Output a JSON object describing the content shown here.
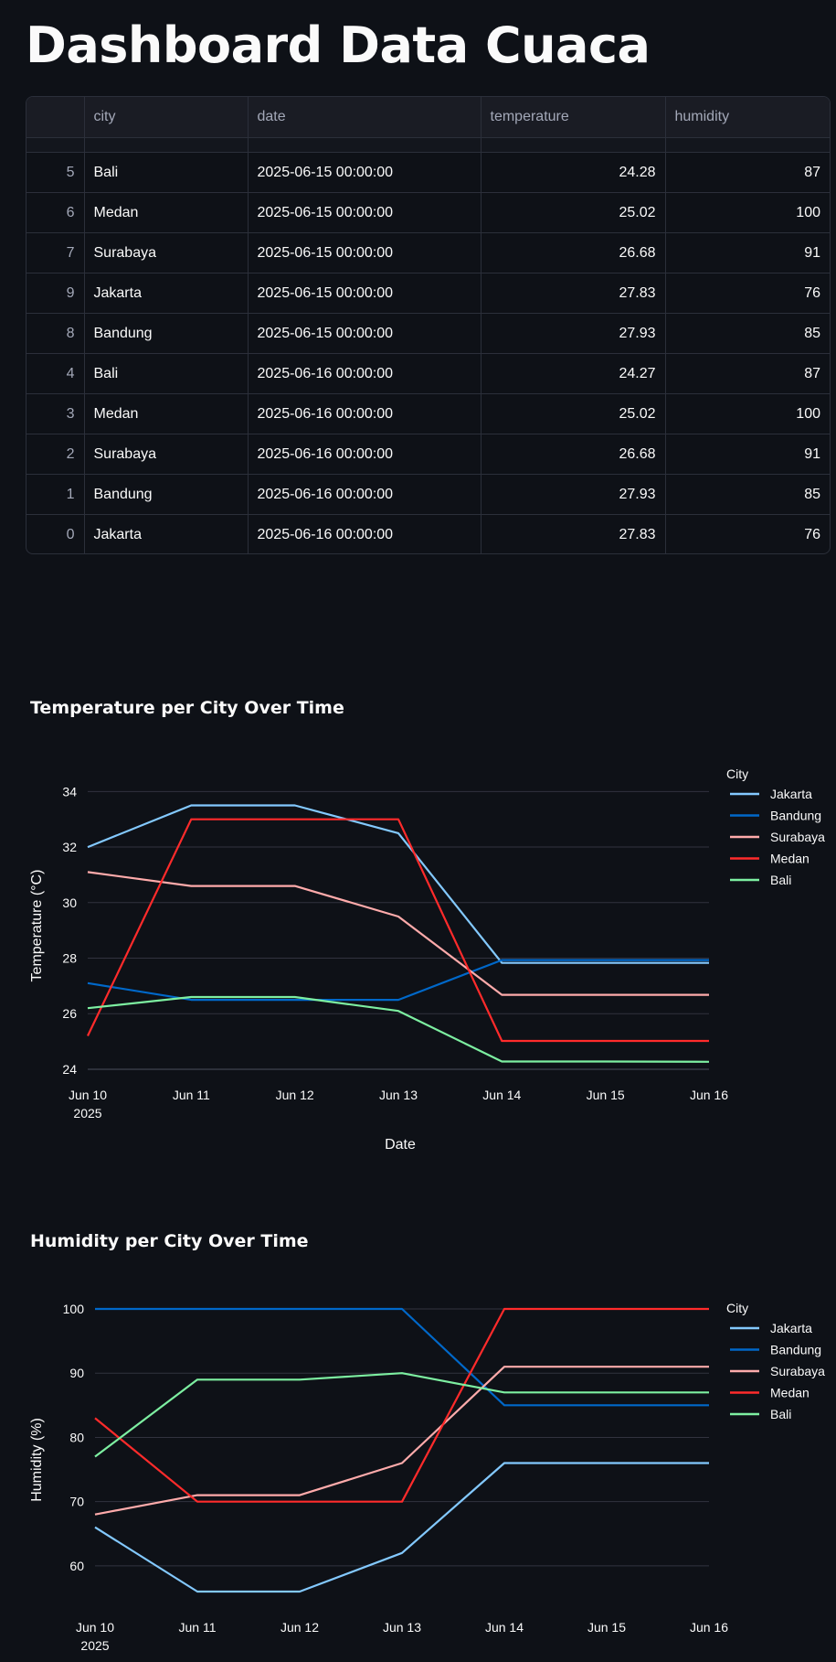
{
  "page": {
    "title": "Dashboard Data Cuaca"
  },
  "table": {
    "columns": [
      "",
      "city",
      "date",
      "temperature",
      "humidity"
    ],
    "rows": [
      [
        "5",
        "Bali",
        "2025-06-15 00:00:00",
        "24.28",
        "87"
      ],
      [
        "6",
        "Medan",
        "2025-06-15 00:00:00",
        "25.02",
        "100"
      ],
      [
        "7",
        "Surabaya",
        "2025-06-15 00:00:00",
        "26.68",
        "91"
      ],
      [
        "9",
        "Jakarta",
        "2025-06-15 00:00:00",
        "27.83",
        "76"
      ],
      [
        "8",
        "Bandung",
        "2025-06-15 00:00:00",
        "27.93",
        "85"
      ],
      [
        "4",
        "Bali",
        "2025-06-16 00:00:00",
        "24.27",
        "87"
      ],
      [
        "3",
        "Medan",
        "2025-06-16 00:00:00",
        "25.02",
        "100"
      ],
      [
        "2",
        "Surabaya",
        "2025-06-16 00:00:00",
        "26.68",
        "91"
      ],
      [
        "1",
        "Bandung",
        "2025-06-16 00:00:00",
        "27.93",
        "85"
      ],
      [
        "0",
        "Jakarta",
        "2025-06-16 00:00:00",
        "27.83",
        "76"
      ]
    ]
  },
  "colors": {
    "Jakarta": "#83c9ff",
    "Bandung": "#0068c9",
    "Surabaya": "#ffabab",
    "Medan": "#ff2b2b",
    "Bali": "#7defa1"
  },
  "chart_data": [
    {
      "type": "line",
      "title": "Temperature per City Over Time",
      "xlabel": "Date",
      "ylabel": "Temperature (°C)",
      "x": [
        "2025-06-10",
        "2025-06-11",
        "2025-06-12",
        "2025-06-13",
        "2025-06-14",
        "2025-06-15",
        "2025-06-16"
      ],
      "x_ticks": [
        "Jun 10",
        "Jun 11",
        "Jun 12",
        "Jun 13",
        "Jun 14",
        "Jun 15",
        "Jun 16"
      ],
      "x_year": "2025",
      "y_ticks": [
        24,
        26,
        28,
        30,
        32,
        34
      ],
      "ylim": [
        23.9,
        34.9
      ],
      "legend_title": "City",
      "legend_position": "right",
      "grid": true,
      "series": [
        {
          "name": "Jakarta",
          "values": [
            32.0,
            33.5,
            33.5,
            32.5,
            27.83,
            27.83,
            27.83
          ]
        },
        {
          "name": "Bandung",
          "values": [
            27.1,
            26.5,
            26.5,
            26.5,
            27.93,
            27.93,
            27.93
          ]
        },
        {
          "name": "Surabaya",
          "values": [
            31.1,
            30.6,
            30.6,
            29.5,
            26.68,
            26.68,
            26.68
          ]
        },
        {
          "name": "Medan",
          "values": [
            25.2,
            33.0,
            33.0,
            33.0,
            25.02,
            25.02,
            25.02
          ]
        },
        {
          "name": "Bali",
          "values": [
            26.2,
            26.6,
            26.6,
            26.1,
            24.28,
            24.28,
            24.27
          ]
        }
      ]
    },
    {
      "type": "line",
      "title": "Humidity per City Over Time",
      "xlabel": "",
      "ylabel": "Humidity (%)",
      "x": [
        "2025-06-10",
        "2025-06-11",
        "2025-06-12",
        "2025-06-13",
        "2025-06-14",
        "2025-06-15",
        "2025-06-16"
      ],
      "x_ticks": [
        "Jun 10",
        "Jun 11",
        "Jun 12",
        "Jun 13",
        "Jun 14",
        "Jun 15",
        "Jun 16"
      ],
      "x_year": "2025",
      "y_ticks": [
        60,
        70,
        80,
        90,
        100
      ],
      "ylim": [
        54,
        101
      ],
      "legend_title": "City",
      "legend_position": "right",
      "grid": true,
      "series": [
        {
          "name": "Jakarta",
          "values": [
            66,
            56,
            56,
            62,
            76,
            76,
            76
          ]
        },
        {
          "name": "Bandung",
          "values": [
            100,
            100,
            100,
            100,
            85,
            85,
            85
          ]
        },
        {
          "name": "Surabaya",
          "values": [
            68,
            71,
            71,
            76,
            91,
            91,
            91
          ]
        },
        {
          "name": "Medan",
          "values": [
            83,
            70,
            70,
            70,
            100,
            100,
            100
          ]
        },
        {
          "name": "Bali",
          "values": [
            77,
            89,
            89,
            90,
            87,
            87,
            87
          ]
        }
      ]
    }
  ]
}
